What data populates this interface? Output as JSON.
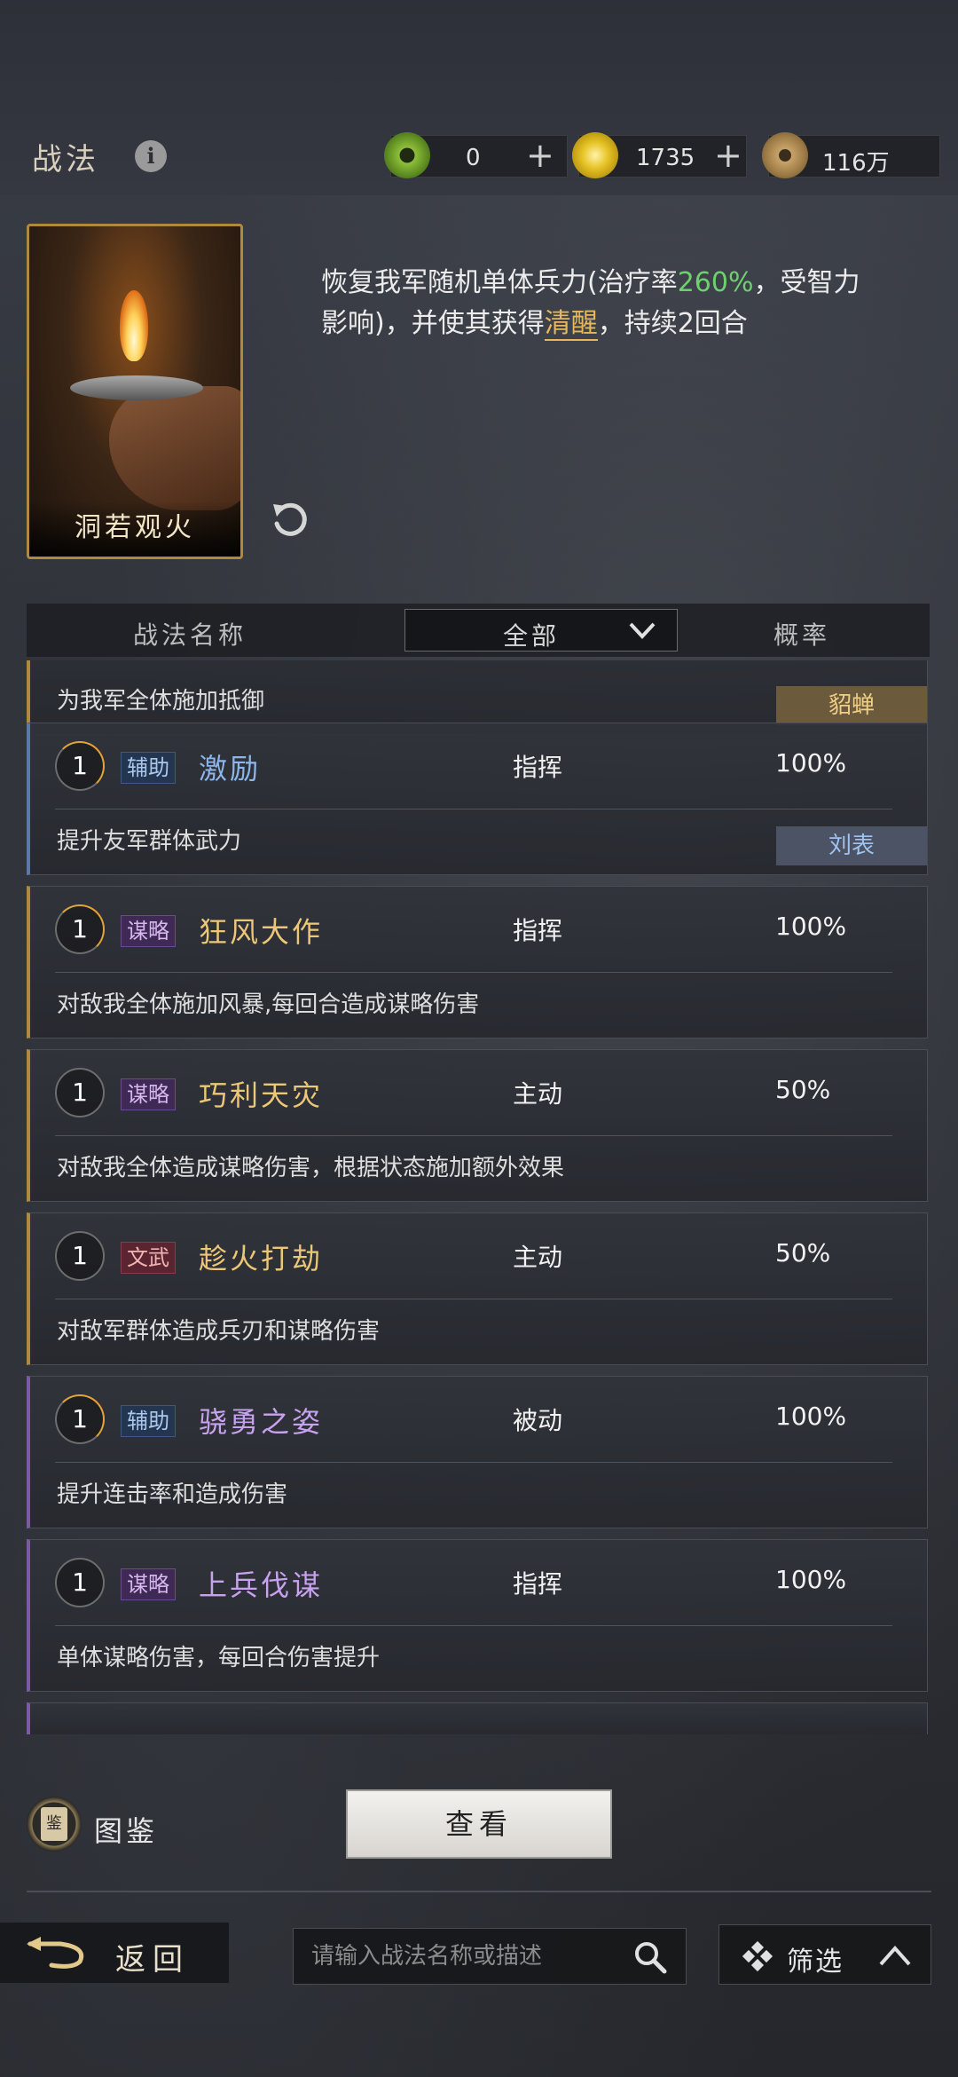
{
  "header": {
    "title": "战法",
    "currencies": [
      {
        "icon": "jade-coin-icon",
        "value": "0",
        "plus": "+"
      },
      {
        "icon": "gold-coin-icon",
        "value": "1735",
        "plus": "+"
      },
      {
        "icon": "copper-coin-icon",
        "value": "116万"
      }
    ]
  },
  "detail": {
    "card_name": "洞若观火",
    "desc_part1": "恢复我军随机单体兵力(治疗率",
    "desc_rate": "260%",
    "desc_part2": "，受智力影响)，并使其获得",
    "desc_status": "清醒",
    "desc_part3": "，持续2回合"
  },
  "list_header": {
    "name": "战法名称",
    "filter": "全部",
    "rate": "概率"
  },
  "partial_top": {
    "desc": "为我军全体施加抵御",
    "owner": "貂蝉"
  },
  "skills": [
    {
      "level": "1",
      "tag": "辅助",
      "name": "激励",
      "type": "指挥",
      "rate": "100%",
      "desc": "提升友军群体武力",
      "owner": "刘表"
    },
    {
      "level": "1",
      "tag": "谋略",
      "name": "狂风大作",
      "type": "指挥",
      "rate": "100%",
      "desc": "对敌我全体施加风暴,每回合造成谋略伤害"
    },
    {
      "level": "1",
      "tag": "谋略",
      "name": "巧利天灾",
      "type": "主动",
      "rate": "50%",
      "desc": "对敌我全体造成谋略伤害，根据状态施加额外效果"
    },
    {
      "level": "1",
      "tag": "文武",
      "name": "趁火打劫",
      "type": "主动",
      "rate": "50%",
      "desc": "对敌军群体造成兵刃和谋略伤害"
    },
    {
      "level": "1",
      "tag": "辅助",
      "name": "骁勇之姿",
      "type": "被动",
      "rate": "100%",
      "desc": "提升连击率和造成伤害"
    },
    {
      "level": "1",
      "tag": "谋略",
      "name": "上兵伐谋",
      "type": "指挥",
      "rate": "100%",
      "desc": "单体谋略伤害，每回合伤害提升"
    }
  ],
  "bottom": {
    "atlas_label": "图鉴",
    "atlas_icon_text": "鉴",
    "view_label": "查看",
    "back_label": "返回",
    "search_placeholder": "请输入战法名称或描述",
    "filter_label": "筛选"
  },
  "colors": {
    "heal_rate": "#6fd06f",
    "status_highlight": "#e6b85c",
    "blue_accent": "#5a79a8",
    "gold_accent": "#b08a3c",
    "purple_accent": "#7c5aa3"
  }
}
